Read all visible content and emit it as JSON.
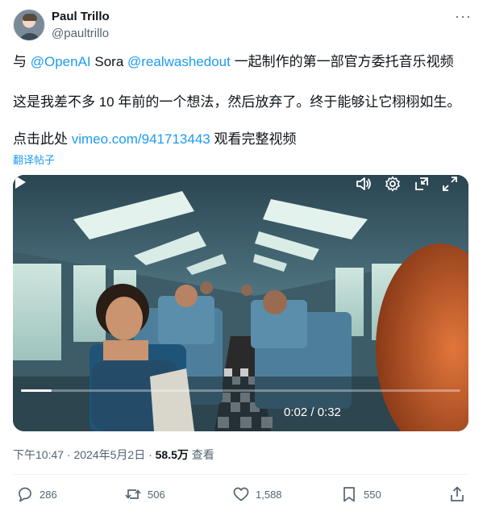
{
  "author": {
    "name": "Paul Trillo",
    "handle": "@paultrillo"
  },
  "tweet": {
    "line1_a": "与 ",
    "mention_openai": "@OpenAI",
    "line1_b": " Sora ",
    "mention_rw": "@realwashedout",
    "line1_c": " 一起制作的第一部官方委托音乐视频",
    "line2": "这是我差不多 10 年前的一个想法，然后放弃了。终于能够让它栩栩如生。",
    "line3_a": "点击此处 ",
    "link": "vimeo.com/941713443",
    "line3_b": " 观看完整视频",
    "translate": "翻译帖子"
  },
  "video": {
    "time": "0:02 / 0:32",
    "progress_fraction": 0.07
  },
  "meta": {
    "datetime": "下午10:47 · 2024年5月2日 · ",
    "views": "58.5万",
    "views_label": " 查看"
  },
  "actions": {
    "replies": "286",
    "reposts": "506",
    "likes": "1,588",
    "bookmarks": "550"
  },
  "colors": {
    "accent": "#1d9bf0",
    "muted": "#536471"
  }
}
